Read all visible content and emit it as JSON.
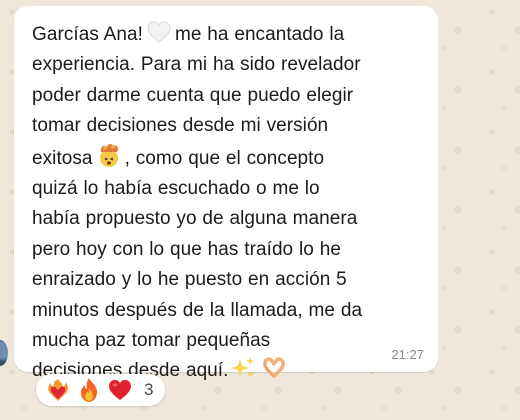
{
  "message": {
    "lines": [
      "Garcías Ana!",
      "me ha encantado la",
      "experiencia. Para mi ha sido revelador",
      "poder darme cuenta que puedo elegir",
      "tomar decisiones desde mi versión",
      "exitosa",
      ", como que el concepto",
      "quizá lo había escuchado o me lo",
      "había propuesto yo de alguna manera",
      "pero hoy con lo que has traído lo he",
      "enraizado y lo he puesto en acción 5",
      "minutos después de la llamada, me da",
      "mucha paz tomar pequeñas",
      "decisiones desde aquí."
    ],
    "inline_icons": [
      "white-heart-icon",
      "exploding-head-icon",
      "sparkles-icon",
      "heart-hands-icon"
    ],
    "timestamp": "21:27"
  },
  "reactions": {
    "icons": [
      "heart-on-fire-icon",
      "fire-icon",
      "red-heart-icon"
    ],
    "count": "3"
  },
  "colors": {
    "bubble": "#ffffff",
    "chat_background": "#efe7dc",
    "text": "#1b1b1b",
    "timestamp": "#8a8a8a"
  }
}
